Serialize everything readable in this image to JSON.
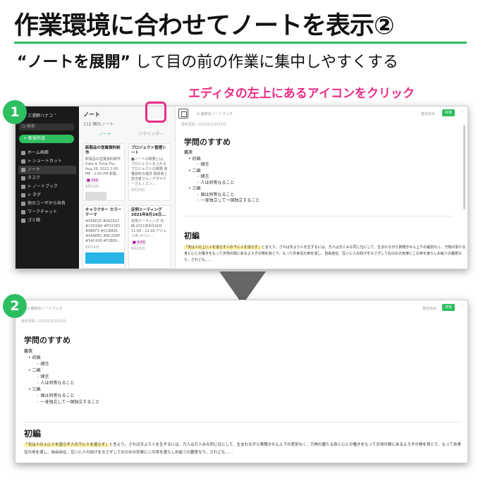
{
  "title": "作業環境に合わせてノートを表示②",
  "subtitle": {
    "emph": "“ノートを展開”",
    "rest": " して目の前の作業に集中しやすくする"
  },
  "callout": "エディタの左上にあるアイコンをクリック",
  "steps": [
    "1",
    "2"
  ],
  "colors": {
    "accent": "#2dbe60",
    "callout": "#ec2c86"
  },
  "sidebar": {
    "user": "三浦野ハナコ ˅",
    "search": "Q 検索",
    "new_button": "+ 新規作成",
    "items": [
      {
        "icon": "home-icon",
        "label": "ホーム画面"
      },
      {
        "icon": "star-icon",
        "label": "> ショートカット"
      },
      {
        "icon": "note-icon",
        "label": "ノート"
      },
      {
        "icon": "check-icon",
        "label": "タスク"
      },
      {
        "icon": "notebook-icon",
        "label": "> ノートブック"
      },
      {
        "icon": "tag-icon",
        "label": "> タグ"
      },
      {
        "icon": "share-icon",
        "label": "他のユーザから共有"
      },
      {
        "icon": "chat-icon",
        "label": "ワークチャット"
      },
      {
        "icon": "trash-icon",
        "label": "ゴミ箱"
      }
    ]
  },
  "notes_list": {
    "header": "ノート",
    "count": "112 個のノート",
    "tabs": [
      "ノート",
      "リマインダー"
    ],
    "cards": [
      {
        "title": "新製品の営業資料制作",
        "body": "新製品の営業資料制作 Date & Time:Thu, Aug 26, 2021 1:00 PM - 2:00 PM 新製...",
        "tag": "■ 209",
        "date": "8月19日"
      },
      {
        "title": "プロジェクト管理シート",
        "body": "■ノートの概要とは。プロジェクトを入れる プロジェクトの概要 各種資料の進捗 関係者と担当者さん / デザイナーさん / エン...",
        "tag": "",
        "date": "8月20日"
      },
      {
        "title": "キャラクター カラーテーマ",
        "body": "#058E2E #062602 #C0D0A0 #F03783 #8BEF3 #CCB806 #64AEB1 #BC2D6F #54C426 #F2BE4...",
        "tag": "",
        "date": "8月14日"
      },
      {
        "title": "定例ミーティング 2021年8月16日...",
        "body": "定例ミーティング 日時:2021年8月16日 11:00 - 12:00 アジェンダ:イベン...",
        "tag": "■ 9:00",
        "date": "8月16日"
      }
    ]
  },
  "editor": {
    "notebook": "⊙ 最初のノートブック",
    "share_settings": "自分のみ",
    "share_button": "共有",
    "more": "···",
    "date": "最終更新: 2020年10月23日",
    "doc_title": "学問のすすめ",
    "toc_label": "目次",
    "toc": [
      {
        "label": "初編",
        "children": [
          "緒言"
        ]
      },
      {
        "label": "二編",
        "children": [
          "緒言",
          "人は同等なること"
        ]
      },
      {
        "label": "三編",
        "children": [
          "国は同等なること",
          "一身独立して一国独立すること"
        ]
      }
    ],
    "section": "初編",
    "quote": "「天は人の上に人を造らず人の下に人を造らず」",
    "paragraph": "と言えり。されば天より人を生ずるには、万人は万人みな同じ位にして、生まれながら貴賤きせん上下の差別なく、万物の霊たる身と心との働きをもって天地の間にあるよろずの物を資とり、もって衣食住の用を達し、自由自在、互いに人の妨げをなさずしておのおの安楽にこの世を渡らしめ給うの趣意なり。されども……"
  }
}
